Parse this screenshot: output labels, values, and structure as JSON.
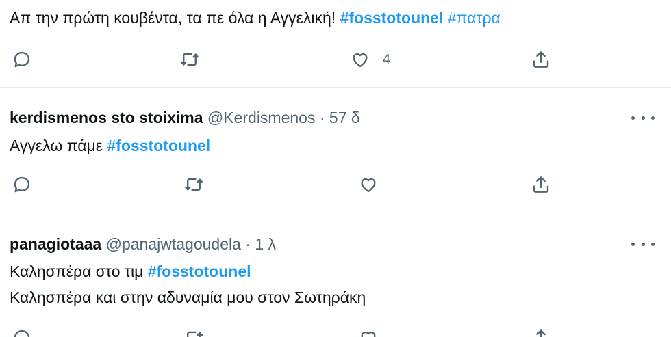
{
  "tweets": [
    {
      "text": "Απ την πρώτη κουβέντα, τα πε όλα η Αγγελική! ",
      "hashtags": [
        "#fosstotounel",
        "#πατρα"
      ],
      "like_count": "4"
    },
    {
      "display_name": "kerdismenos sto stoixima",
      "handle": "@Kerdismenos",
      "separator": "·",
      "time": "57 δ",
      "text": "Αγγελω πάμε ",
      "hashtags": [
        "#fosstotounel"
      ]
    },
    {
      "display_name": "panagiotaaa",
      "handle": "@panajwtagoudela",
      "separator": "·",
      "time": "1 λ",
      "text_line1": "Καλησπέρα στο τιμ ",
      "hashtags": [
        "#fosstotounel"
      ],
      "text_line2": "Καλησπέρα και στην αδυναμία μου στον Σωτηράκη"
    }
  ],
  "icons": {
    "reply": "reply-icon",
    "retweet": "retweet-icon",
    "like": "heart-icon",
    "share": "share-icon",
    "more": "more-icon"
  },
  "colors": {
    "hashtag": "#1d9bf0",
    "icon": "#536471",
    "text": "#0f1419",
    "divider": "#e6ecf0"
  }
}
